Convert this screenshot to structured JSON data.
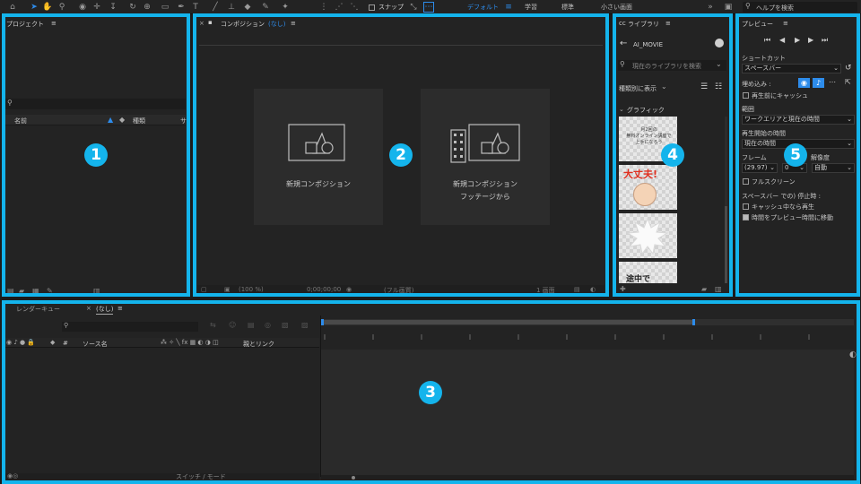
{
  "toolbar": {
    "snap_label": "スナップ",
    "workspaces": [
      "デフォルト",
      "学習",
      "標準",
      "小さい画面"
    ],
    "search_placeholder": "ヘルプを検索"
  },
  "project": {
    "title": "プロジェクト",
    "col_name": "名前",
    "col_type": "種類",
    "col_size": "サ"
  },
  "composition": {
    "title": "コンポジション",
    "name": "(なし)",
    "card1_label": "新規コンポジション",
    "card2_line1": "新規コンポジション",
    "card2_line2": "フッテージから",
    "footer_zoom": "(100 %)",
    "footer_time": "0;00;00;00",
    "footer_res": "(フル画質)",
    "footer_views": "1 画面"
  },
  "timeline": {
    "render_queue_tab": "レンダーキュー",
    "comp_tab": "(なし)",
    "col_hash": "#",
    "col_source": "ソース名",
    "col_parent": "親とリンク",
    "switch_mode": "スイッチ / モード"
  },
  "library": {
    "title": "ライブラリ",
    "name": "AI_MOVIE",
    "search_placeholder": "現在のライブラリを検索",
    "view_label": "種類別に表示",
    "section": "グラフィック",
    "thumb1_text": "月2回の\n無料オンライン講座で\n上手になろう",
    "thumb2_text": "大丈夫!",
    "thumb4_text": "途中で"
  },
  "preview": {
    "title": "プレビュー",
    "shortcut_label": "ショートカット",
    "shortcut_value": "スペースバー",
    "include_label": "埋め込み :",
    "cache_before": "再生前にキャッシュ",
    "range_label": "範囲",
    "range_value": "ワークエリアと現在の時間",
    "start_label": "再生開始の時間",
    "start_value": "現在の時間",
    "frame_label": "フレーム",
    "skip_label": "ス",
    "resolution_label": "解像度",
    "fps_value": "(29.97)",
    "skip_value": "0",
    "res_value": "自動",
    "fullscreen": "フルスクリーン",
    "stop_label": "スペースバー での) 停止時 :",
    "cache_play": "キャッシュ中なら再生",
    "move_time": "時間をプレビュー時間に移動"
  },
  "badges": [
    "1",
    "2",
    "3",
    "4",
    "5"
  ],
  "colors": {
    "highlight": "#14b4ec",
    "accent": "#2d8ceb",
    "panel": "#232323"
  }
}
